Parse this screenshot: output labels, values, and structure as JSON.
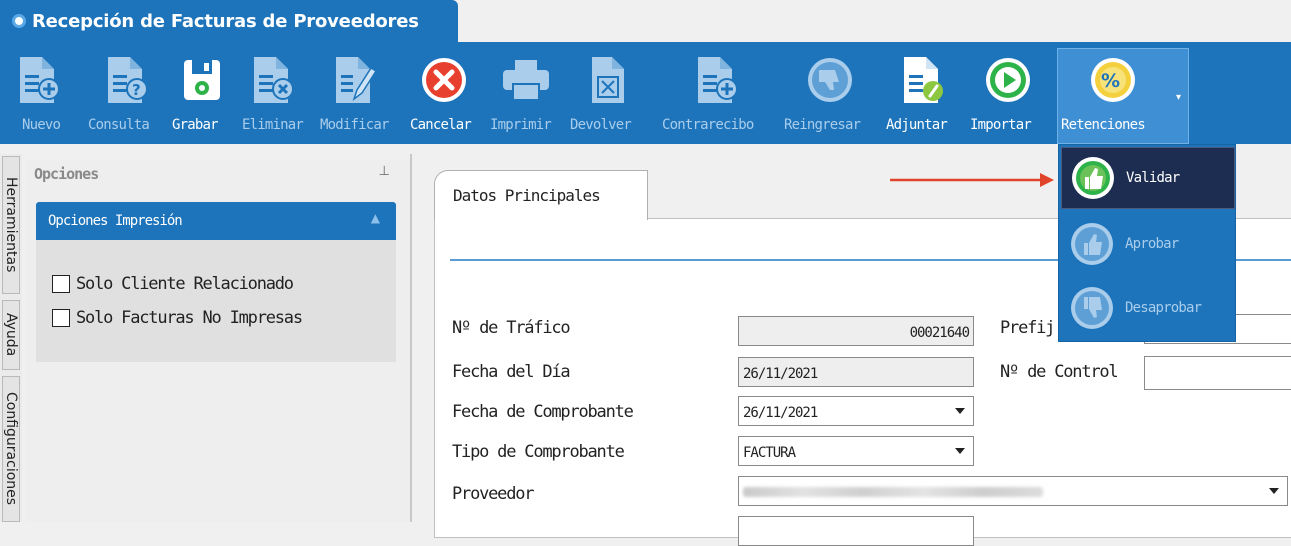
{
  "window": {
    "title": "Recepción de Facturas de Proveedores"
  },
  "toolbar": {
    "buttons": [
      {
        "label": "Nuevo",
        "icon": "document-add-icon",
        "enabled": false
      },
      {
        "label": "Consulta",
        "icon": "document-question-icon",
        "enabled": false
      },
      {
        "label": "Grabar",
        "icon": "save-icon",
        "enabled": true
      },
      {
        "label": "Eliminar",
        "icon": "document-delete-icon",
        "enabled": false
      },
      {
        "label": "Modificar",
        "icon": "document-edit-icon",
        "enabled": false
      },
      {
        "label": "Cancelar",
        "icon": "cancel-icon",
        "enabled": true
      },
      {
        "label": "Imprimir",
        "icon": "printer-icon",
        "enabled": false
      },
      {
        "label": "Devolver",
        "icon": "document-return-icon",
        "enabled": false
      },
      {
        "label": "Contrarecibo",
        "icon": "document-receipt-icon",
        "enabled": false
      },
      {
        "label": "Reingresar",
        "icon": "thumbs-down-icon",
        "enabled": false
      },
      {
        "label": "Adjuntar",
        "icon": "attach-icon",
        "enabled": true
      },
      {
        "label": "Importar",
        "icon": "play-icon",
        "enabled": true
      },
      {
        "label": "Retenciones",
        "icon": "percent-icon",
        "enabled": true
      }
    ]
  },
  "side_tabs": [
    "Herramientas",
    "Ayuda",
    "Configuraciones"
  ],
  "options_panel": {
    "title": "Opciones",
    "section_title": "Opciones Impresión",
    "checkboxes": [
      {
        "label": "Solo Cliente Relacionado",
        "checked": false
      },
      {
        "label": "Solo Facturas No Impresas",
        "checked": false
      }
    ]
  },
  "main": {
    "tab_label": "Datos Principales",
    "fields": {
      "trafico_label": "Nº de Tráfico",
      "trafico_value": "00021640",
      "fecha_dia_label": "Fecha del Día",
      "fecha_dia_value": "26/11/2021",
      "fecha_comp_label": "Fecha de Comprobante",
      "fecha_comp_value": "26/11/2021",
      "tipo_comp_label": "Tipo de Comprobante",
      "tipo_comp_value": "FACTURA",
      "proveedor_label": "Proveedor",
      "prefijo_label": "Prefij",
      "control_label": "Nº de Control"
    }
  },
  "retenciones_menu": {
    "items": [
      {
        "label": "Validar",
        "icon": "thumbs-up-icon",
        "active": true
      },
      {
        "label": "Aprobar",
        "icon": "thumbs-up-icon",
        "active": false
      },
      {
        "label": "Desaprobar",
        "icon": "thumbs-down-icon",
        "active": false
      }
    ]
  },
  "colors": {
    "toolbar_blue": "#1d74bb",
    "menu_active": "#1d2d52",
    "arrow_red": "#e0452b",
    "cancel_red": "#e8402e",
    "green": "#2db34a",
    "yellow": "#f4d03f"
  }
}
